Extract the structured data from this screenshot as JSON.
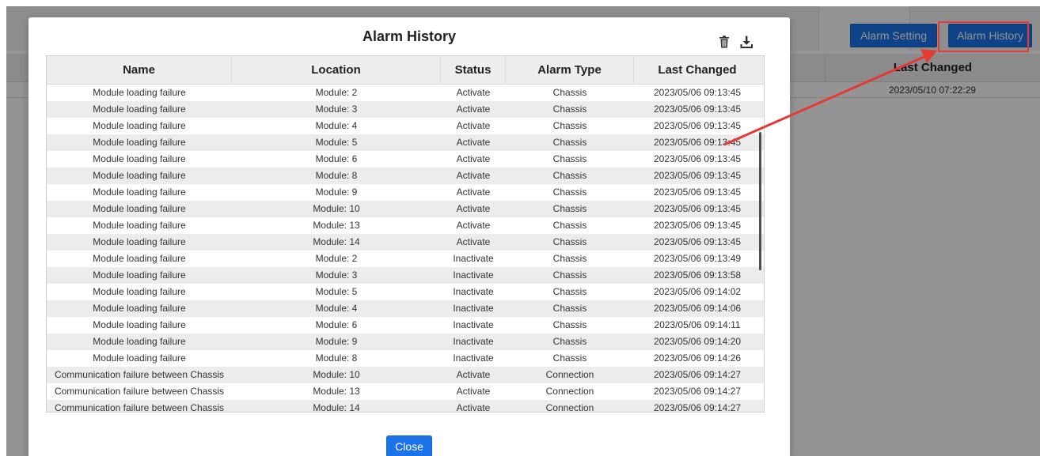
{
  "background": {
    "alarm_setting_label": "Alarm Setting",
    "alarm_history_label": "Alarm History",
    "last_changed_header": "Last Changed",
    "last_changed_value": "2023/05/10 07:22:29"
  },
  "modal": {
    "title": "Alarm History",
    "close_label": "Close",
    "columns": [
      "Name",
      "Location",
      "Status",
      "Alarm Type",
      "Last Changed"
    ],
    "rows": [
      [
        "Module loading failure",
        "Module: 2",
        "Activate",
        "Chassis",
        "2023/05/06 09:13:45"
      ],
      [
        "Module loading failure",
        "Module: 3",
        "Activate",
        "Chassis",
        "2023/05/06 09:13:45"
      ],
      [
        "Module loading failure",
        "Module: 4",
        "Activate",
        "Chassis",
        "2023/05/06 09:13:45"
      ],
      [
        "Module loading failure",
        "Module: 5",
        "Activate",
        "Chassis",
        "2023/05/06 09:13:45"
      ],
      [
        "Module loading failure",
        "Module: 6",
        "Activate",
        "Chassis",
        "2023/05/06 09:13:45"
      ],
      [
        "Module loading failure",
        "Module: 8",
        "Activate",
        "Chassis",
        "2023/05/06 09:13:45"
      ],
      [
        "Module loading failure",
        "Module: 9",
        "Activate",
        "Chassis",
        "2023/05/06 09:13:45"
      ],
      [
        "Module loading failure",
        "Module: 10",
        "Activate",
        "Chassis",
        "2023/05/06 09:13:45"
      ],
      [
        "Module loading failure",
        "Module: 13",
        "Activate",
        "Chassis",
        "2023/05/06 09:13:45"
      ],
      [
        "Module loading failure",
        "Module: 14",
        "Activate",
        "Chassis",
        "2023/05/06 09:13:45"
      ],
      [
        "Module loading failure",
        "Module: 2",
        "Inactivate",
        "Chassis",
        "2023/05/06 09:13:49"
      ],
      [
        "Module loading failure",
        "Module: 3",
        "Inactivate",
        "Chassis",
        "2023/05/06 09:13:58"
      ],
      [
        "Module loading failure",
        "Module: 5",
        "Inactivate",
        "Chassis",
        "2023/05/06 09:14:02"
      ],
      [
        "Module loading failure",
        "Module: 4",
        "Inactivate",
        "Chassis",
        "2023/05/06 09:14:06"
      ],
      [
        "Module loading failure",
        "Module: 6",
        "Inactivate",
        "Chassis",
        "2023/05/06 09:14:11"
      ],
      [
        "Module loading failure",
        "Module: 9",
        "Inactivate",
        "Chassis",
        "2023/05/06 09:14:20"
      ],
      [
        "Module loading failure",
        "Module: 8",
        "Inactivate",
        "Chassis",
        "2023/05/06 09:14:26"
      ],
      [
        "Communication failure between Chassis",
        "Module: 10",
        "Activate",
        "Connection",
        "2023/05/06 09:14:27"
      ],
      [
        "Communication failure between Chassis",
        "Module: 13",
        "Activate",
        "Connection",
        "2023/05/06 09:14:27"
      ],
      [
        "Communication failure between Chassis",
        "Module: 14",
        "Activate",
        "Connection",
        "2023/05/06 09:14:27"
      ]
    ],
    "highlighted_row": 3
  },
  "icons": {
    "trash": "trash-icon",
    "download": "download-icon"
  },
  "colors": {
    "accent": "#1a73e8",
    "annotation": "#e53935"
  }
}
